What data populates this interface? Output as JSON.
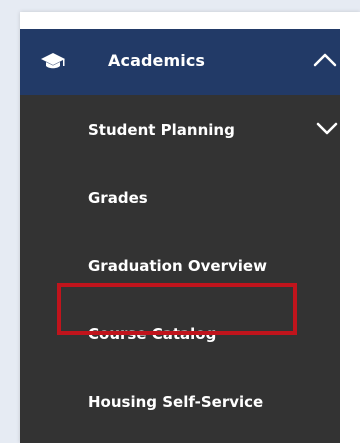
{
  "nav": {
    "header": {
      "label": "Academics",
      "icon": "graduation-cap-icon",
      "expand_icon": "chevron-up-icon",
      "background": "#223a67"
    },
    "items": [
      {
        "label": "Student Planning",
        "icon": "chevron-down-icon"
      },
      {
        "label": "Grades"
      },
      {
        "label": "Graduation Overview"
      },
      {
        "label": "Course Catalog"
      },
      {
        "label": "Housing Self-Service",
        "highlighted": true
      }
    ],
    "menu_background": "#333333",
    "highlight_color": "#c0141c"
  }
}
